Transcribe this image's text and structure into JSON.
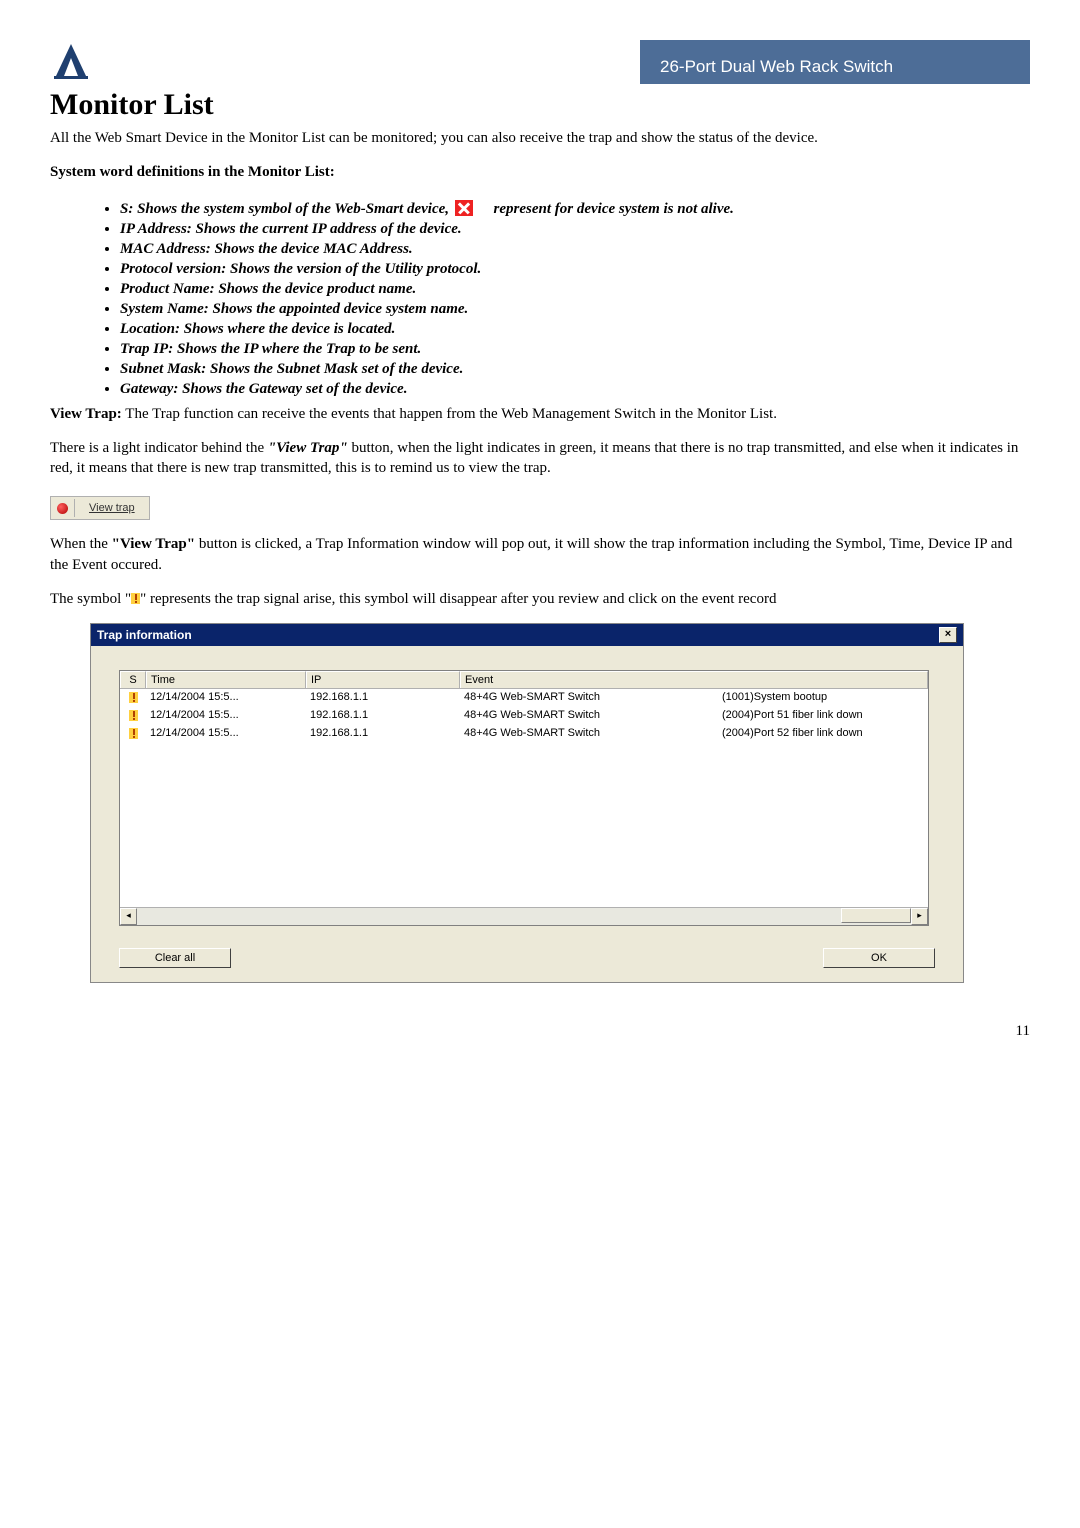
{
  "header": {
    "band": "26-Port Dual Web Rack Switch"
  },
  "title": "Monitor List",
  "intro": "All the Web Smart Device in the Monitor List can be monitored; you can also receive the trap and show the status of the device.",
  "defs_heading": "System word definitions in the Monitor List:",
  "bullets": {
    "s_before": "S: Shows the system symbol of the Web-Smart device,",
    "s_after": "represent for device system is not alive.",
    "ip": "IP Address: Shows the current IP address of the device.",
    "mac": "MAC Address: Shows the device MAC Address.",
    "protocol": "Protocol version: Shows the version of the Utility protocol.",
    "product": "Product Name: Shows the device product name.",
    "system": "System Name: Shows the appointed device system name.",
    "location": "Location: Shows where the device is located.",
    "trapip": "Trap IP: Shows the IP where the Trap to be sent.",
    "subnet": "Subnet Mask: Shows the Subnet Mask set of the device.",
    "gateway": "Gateway: Shows the Gateway set of the device."
  },
  "viewtrap_p1_bold": "View Trap:",
  "viewtrap_p1_rest": " The Trap function can receive the events that happen from the Web Management Switch in the Monitor List.",
  "viewtrap_p2a": "There is a light indicator behind the ",
  "viewtrap_p2_quote": "\"View Trap\"",
  "viewtrap_p2b": " button, when the light indicates in green, it means that there is no trap transmitted, and else when it indicates in red, it means that there is new trap transmitted, this is to remind us to view the trap.",
  "viewtrap_btn": "View trap",
  "p3a": "When the ",
  "p3_quote": "\"View Trap\"",
  "p3b": " button is clicked, a Trap Information window will pop out, it will show the trap information including the Symbol, Time, Device IP and the Event occured.",
  "p4a": "The symbol \"",
  "p4b": "\" represents the trap signal arise, this symbol will disappear after you review and click on the event record",
  "trapwin": {
    "title": "Trap information",
    "close": "×",
    "cols": {
      "s": "S",
      "time": "Time",
      "ip": "IP",
      "event": "Event"
    },
    "rows": [
      {
        "time": "12/14/2004 15:5...",
        "ip": "192.168.1.1",
        "ename": "48+4G Web-SMART Switch",
        "edesc": "(1001)System bootup"
      },
      {
        "time": "12/14/2004 15:5...",
        "ip": "192.168.1.1",
        "ename": "48+4G Web-SMART Switch",
        "edesc": "(2004)Port 51 fiber link down"
      },
      {
        "time": "12/14/2004 15:5...",
        "ip": "192.168.1.1",
        "ename": "48+4G Web-SMART Switch",
        "edesc": "(2004)Port 52 fiber link down"
      }
    ],
    "clear": "Clear all",
    "ok": "OK"
  },
  "page": "11"
}
